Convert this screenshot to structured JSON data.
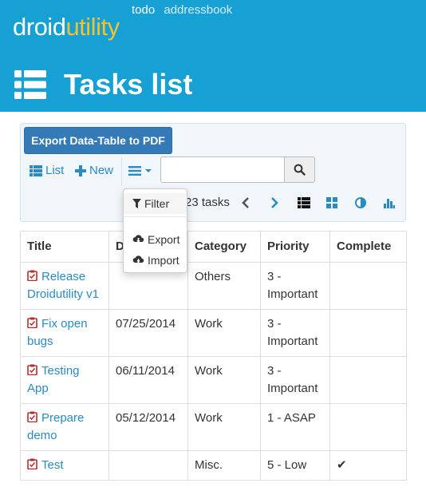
{
  "header": {
    "brand_part1": "droid",
    "brand_part2": "utility",
    "nav": [
      "todo",
      "addressbook"
    ],
    "page_title": "Tasks list"
  },
  "toolbar": {
    "export_pdf_label": "Export Data-Table to PDF",
    "list_label": "List",
    "new_label": "New",
    "search_value": "",
    "task_count": "23 tasks",
    "view_icons": [
      "list-view-icon",
      "grid-view-icon",
      "contrast-icon",
      "chart-icon"
    ]
  },
  "dropdown": {
    "filter_label": "Filter",
    "export_label": "Export",
    "import_label": "Import"
  },
  "table": {
    "headers": [
      "Title",
      "D",
      "Category",
      "Priority",
      "Complete"
    ],
    "rows": [
      {
        "title": "Release Droidutility v1",
        "date": "",
        "category": "Others",
        "priority": "3 - Important",
        "complete": ""
      },
      {
        "title": "Fix open bugs",
        "date": "07/25/2014",
        "category": "Work",
        "priority": "3 - Important",
        "complete": ""
      },
      {
        "title": "Testing App",
        "date": "06/11/2014",
        "category": "Work",
        "priority": "3 - Important",
        "complete": ""
      },
      {
        "title": "Prepare demo",
        "date": "05/12/2014",
        "category": "Work",
        "priority": "1 - ASAP",
        "complete": ""
      },
      {
        "title": "Test",
        "date": "",
        "category": "Misc.",
        "priority": "5 - Low",
        "complete": "✔"
      }
    ]
  },
  "colors": {
    "header_bg": "#16a0d3",
    "brand_accent": "#f1c232",
    "primary_button": "#337ab7",
    "link": "#2a8ac4"
  }
}
